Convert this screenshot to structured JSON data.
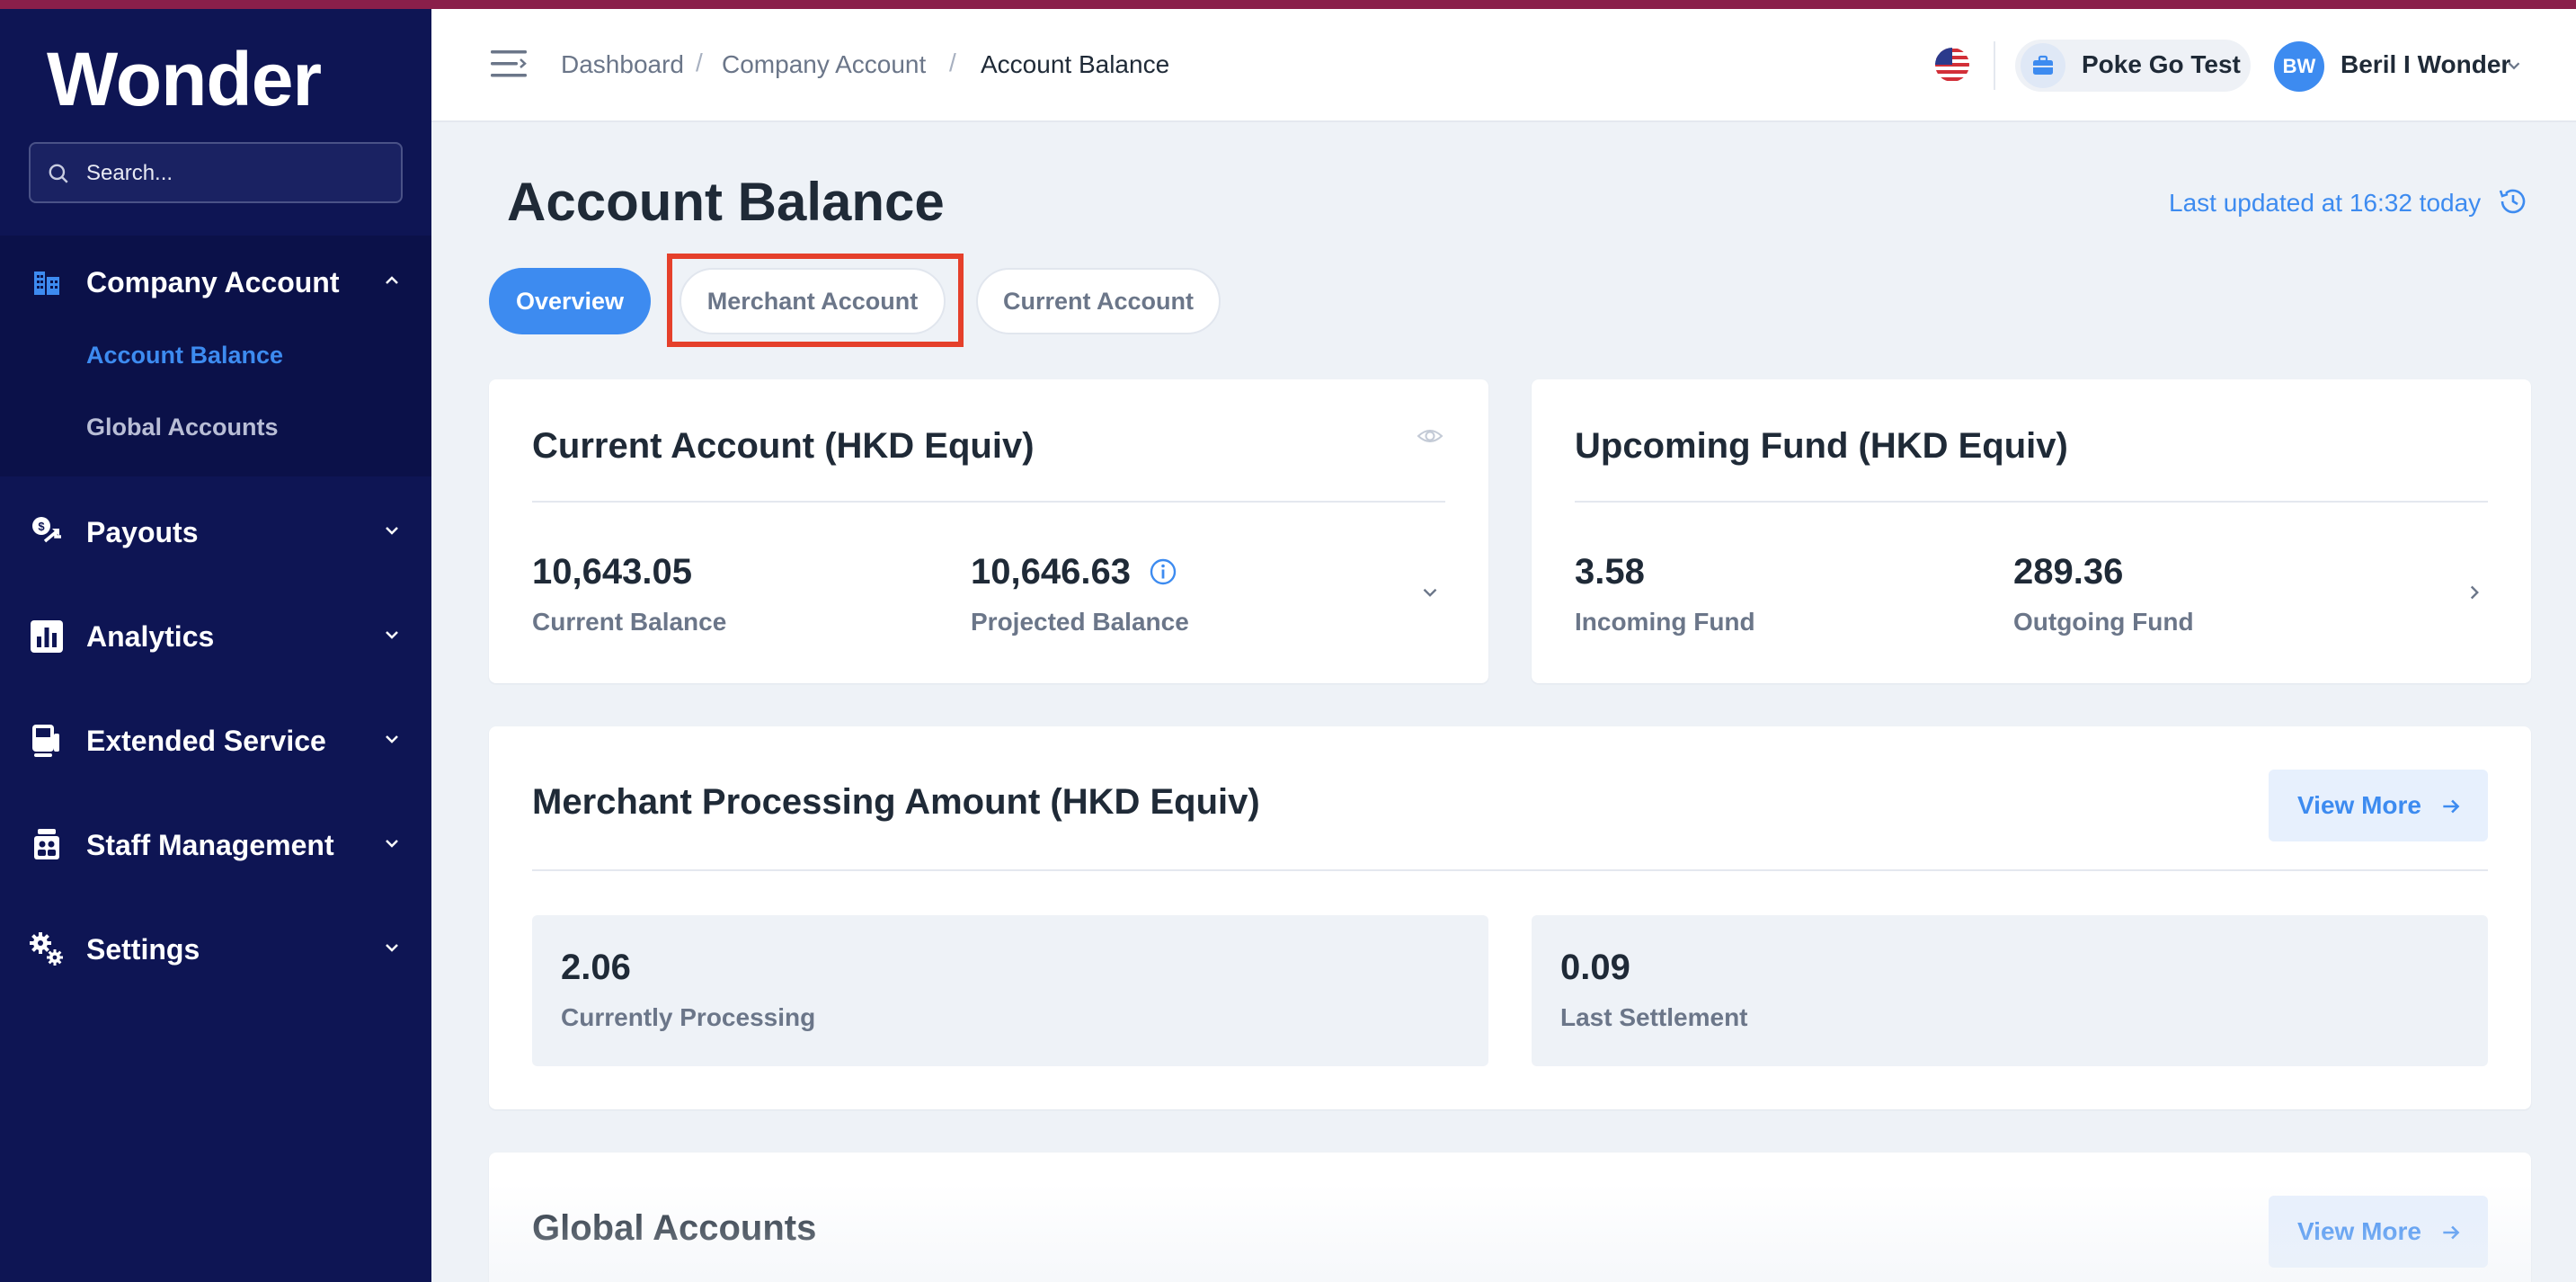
{
  "app": {
    "name": "Wonder",
    "brand_color": "#0e1554",
    "accent_color": "#3d8bf0"
  },
  "sidebar": {
    "search": {
      "placeholder": "Search...",
      "value": ""
    },
    "nav": [
      {
        "label": "Company Account",
        "icon": "building-icon",
        "expanded": true,
        "children": [
          {
            "label": "Account Balance",
            "active": true
          },
          {
            "label": "Global Accounts",
            "active": false
          }
        ]
      },
      {
        "label": "Payouts",
        "icon": "payout-icon",
        "expanded": false
      },
      {
        "label": "Analytics",
        "icon": "bar-chart-icon",
        "expanded": false
      },
      {
        "label": "Extended Service",
        "icon": "terminal-icon",
        "expanded": false
      },
      {
        "label": "Staff Management",
        "icon": "staff-icon",
        "expanded": false
      },
      {
        "label": "Settings",
        "icon": "gears-icon",
        "expanded": false
      }
    ]
  },
  "header": {
    "breadcrumb": [
      "Dashboard",
      "Company Account",
      "Account Balance"
    ],
    "language_flag": "us-flag-icon",
    "business_name": "Poke Go Test",
    "user_initials": "BW",
    "user_name": "Beril I Wonder"
  },
  "main": {
    "title": "Account Balance",
    "last_updated": "Last updated at 16:32 today",
    "tabs": [
      {
        "label": "Overview",
        "active": true
      },
      {
        "label": "Merchant Account",
        "active": false,
        "highlighted": true
      },
      {
        "label": "Current Account",
        "active": false
      }
    ],
    "current_account_card": {
      "title": "Current Account (HKD Equiv)",
      "current_balance": {
        "value": "10,643.05",
        "label": "Current Balance"
      },
      "projected_balance": {
        "value": "10,646.63",
        "label": "Projected Balance"
      }
    },
    "upcoming_fund_card": {
      "title": "Upcoming Fund (HKD Equiv)",
      "incoming": {
        "value": "3.58",
        "label": "Incoming Fund"
      },
      "outgoing": {
        "value": "289.36",
        "label": "Outgoing Fund"
      }
    },
    "merchant_processing_card": {
      "title": "Merchant Processing Amount (HKD Equiv)",
      "view_more": "View More",
      "currently_processing": {
        "value": "2.06",
        "label": "Currently Processing"
      },
      "last_settlement": {
        "value": "0.09",
        "label": "Last Settlement"
      }
    },
    "global_accounts_card": {
      "title": "Global Accounts",
      "view_more": "View More"
    }
  }
}
